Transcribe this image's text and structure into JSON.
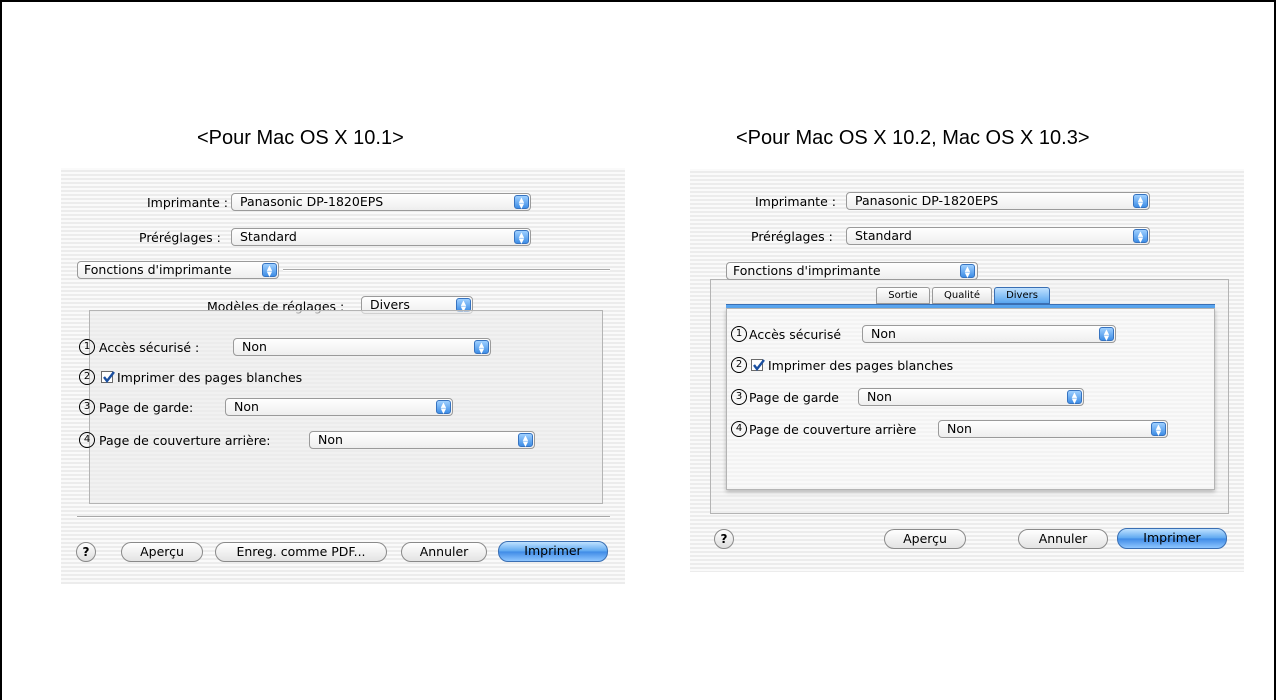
{
  "left": {
    "caption": "<Pour Mac OS X 10.1>",
    "printer_label": "Imprimante :",
    "printer_value": "Panasonic DP-1820EPS",
    "presets_label": "Préréglages :",
    "presets_value": "Standard",
    "section_value": "Fonctions d'imprimante",
    "models_label": "Modèles de réglages :",
    "models_value": "Divers",
    "options": [
      {
        "num": "1",
        "label": "Accès sécurisé :",
        "value": "Non"
      },
      {
        "num": "2",
        "label": "Imprimer des pages blanches",
        "checked": true
      },
      {
        "num": "3",
        "label": "Page de garde:",
        "value": "Non"
      },
      {
        "num": "4",
        "label": "Page de couverture arrière:",
        "value": "Non"
      }
    ],
    "buttons": {
      "help": "?",
      "preview": "Aperçu",
      "save_pdf": "Enreg. comme PDF...",
      "cancel": "Annuler",
      "print": "Imprimer"
    }
  },
  "right": {
    "caption": "<Pour Mac OS X 10.2, Mac OS X 10.3>",
    "printer_label": "Imprimante :",
    "printer_value": "Panasonic DP-1820EPS",
    "presets_label": "Préréglages :",
    "presets_value": "Standard",
    "section_value": "Fonctions d'imprimante",
    "tabs": [
      "Sortie",
      "Qualité",
      "Divers"
    ],
    "active_tab": "Divers",
    "options": [
      {
        "num": "1",
        "label": "Accès sécurisé",
        "value": "Non"
      },
      {
        "num": "2",
        "label": "Imprimer des pages blanches",
        "checked": true
      },
      {
        "num": "3",
        "label": "Page de garde",
        "value": "Non"
      },
      {
        "num": "4",
        "label": "Page de couverture arrière",
        "value": "Non"
      }
    ],
    "buttons": {
      "help": "?",
      "preview": "Aperçu",
      "cancel": "Annuler",
      "print": "Imprimer"
    }
  },
  "icons": {
    "popup_arrows": "updown-arrows-icon",
    "checkbox": "checkmark-icon",
    "help": "question-mark-icon"
  },
  "colors": {
    "accent": "#3e8ae6"
  }
}
